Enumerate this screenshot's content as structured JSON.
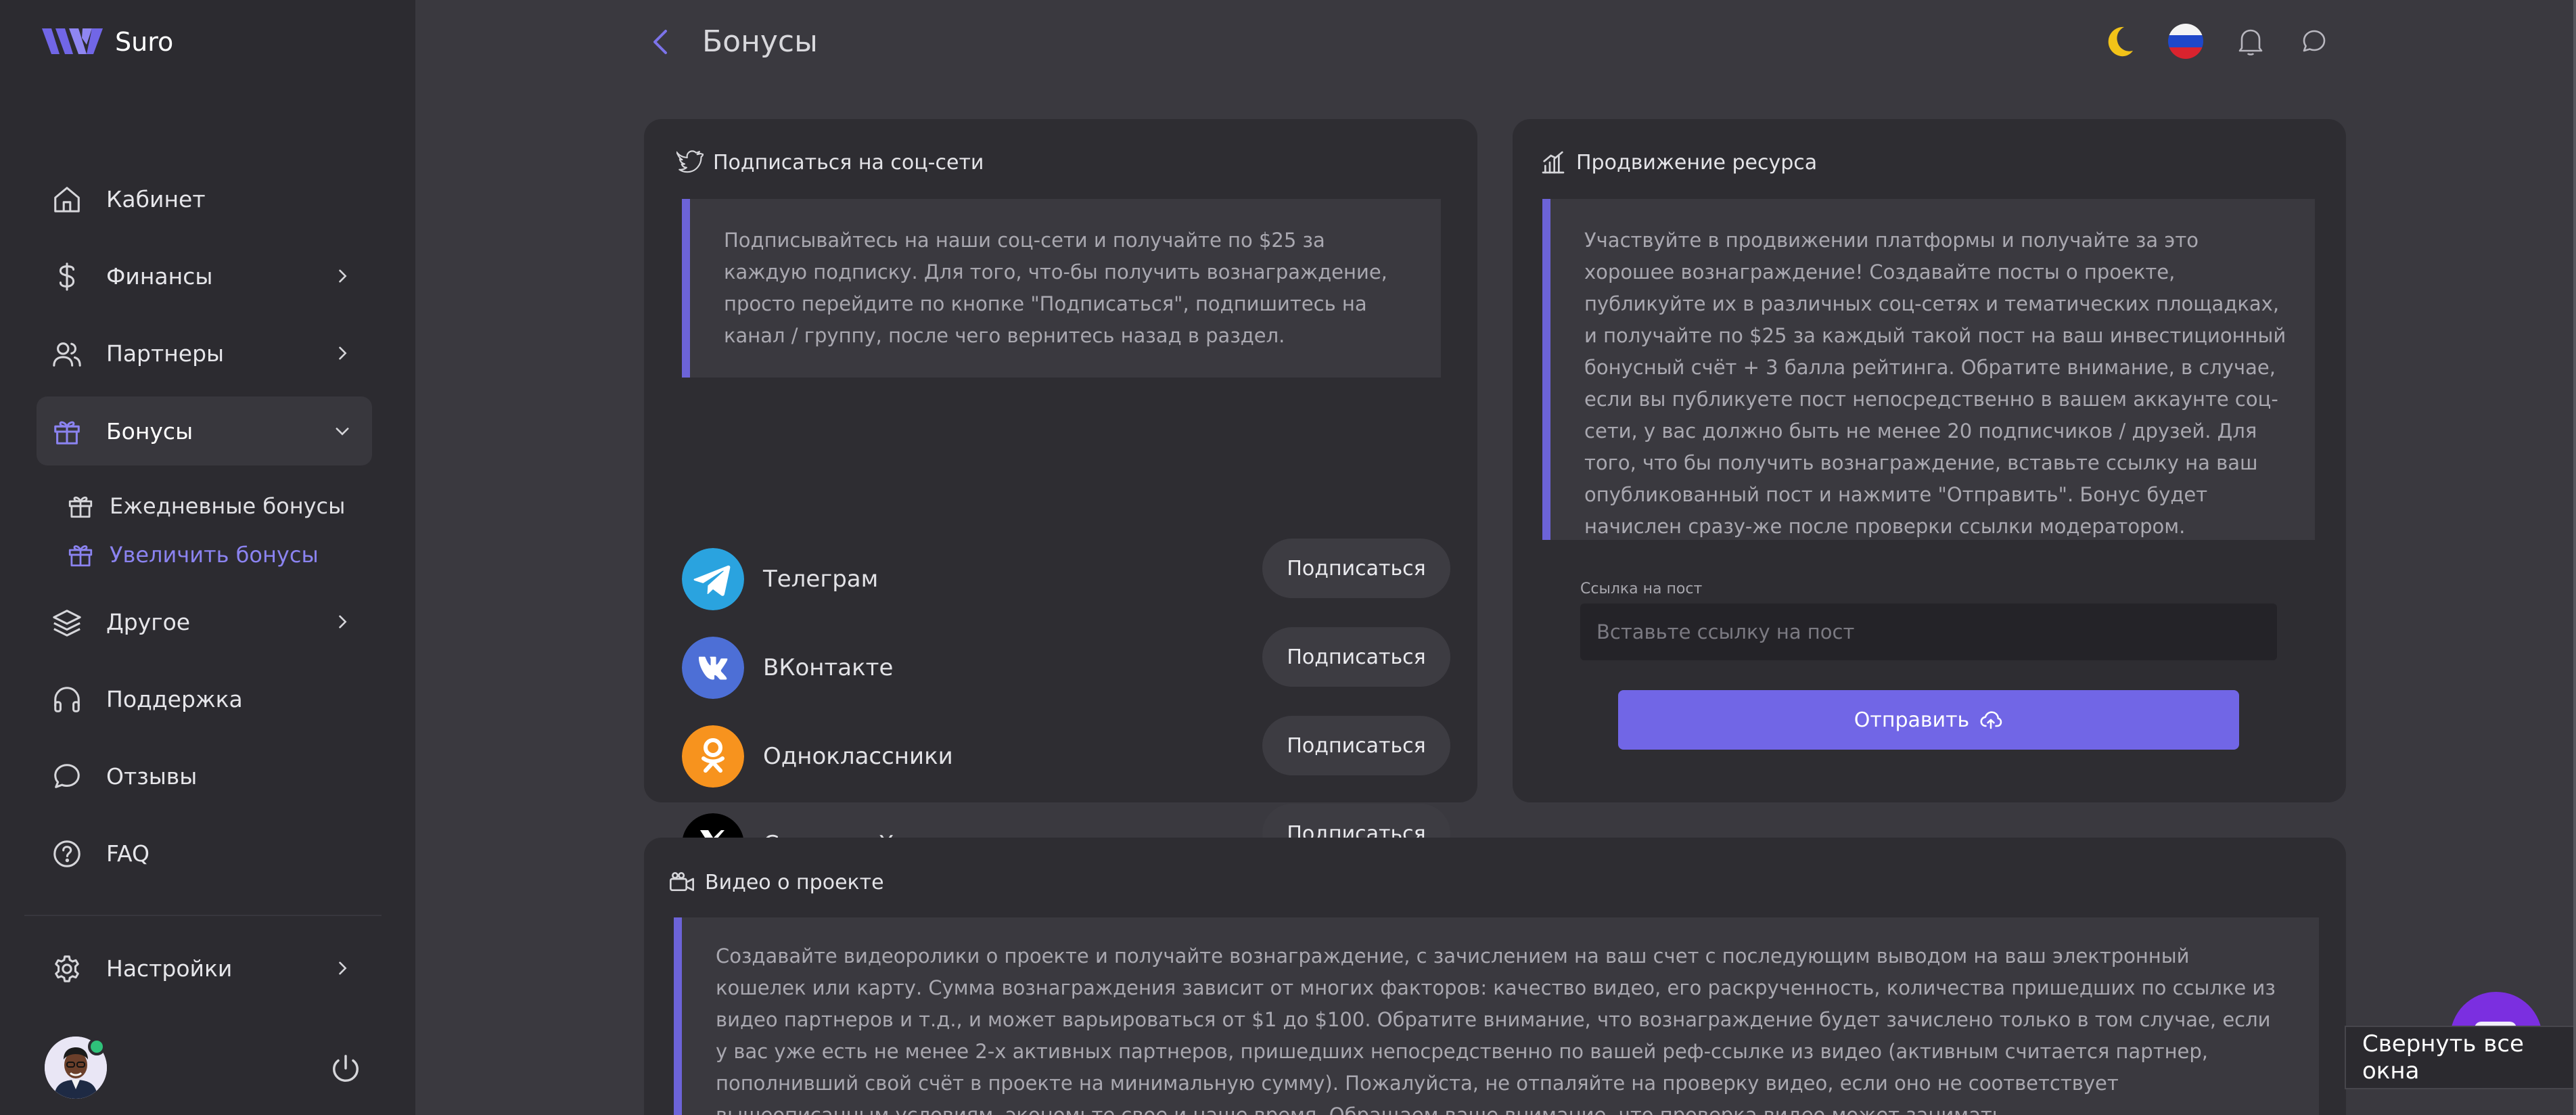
{
  "app": {
    "name": "Suro",
    "accent": "#6c63d8"
  },
  "sidebar": {
    "items": [
      {
        "label": "Кабинет",
        "icon": "home-icon"
      },
      {
        "label": "Финансы",
        "icon": "dollar-icon"
      },
      {
        "label": "Партнеры",
        "icon": "users-icon"
      },
      {
        "label": "Бонусы",
        "icon": "gift-icon"
      },
      {
        "label": "Другое",
        "icon": "layers-icon"
      },
      {
        "label": "Поддержка",
        "icon": "headphones-icon"
      },
      {
        "label": "Отзывы",
        "icon": "chat-bubble-icon"
      },
      {
        "label": "FAQ",
        "icon": "help-circle-icon"
      },
      {
        "label": "Настройки",
        "icon": "gear-icon"
      }
    ],
    "bonus_sub": [
      {
        "label": "Ежедневные бонусы",
        "icon": "gift-icon"
      },
      {
        "label": "Увеличить бонусы",
        "icon": "gift-icon"
      }
    ]
  },
  "header": {
    "title": "Бонусы"
  },
  "social_card": {
    "title": "Подписаться на соц-сети",
    "description": "Подписывайтесь на наши соц-сети и получайте по $25 за каждую подписку. Для того, что-бы получить вознаграждение, просто перейдите по кнопке \"Подписаться\", подпишитесь на канал / группу, после чего вернитесь назад в раздел.",
    "networks": [
      {
        "name": "Телеграм",
        "button": "Подписаться",
        "color": "#2aa3df"
      },
      {
        "name": "ВКонтакте",
        "button": "Подписаться",
        "color": "#4d6fd6"
      },
      {
        "name": "Одноклассники",
        "button": "Подписаться",
        "color": "#f7931e"
      },
      {
        "name": "Соц-сеть X",
        "button": "Подписаться",
        "color": "#000000"
      }
    ]
  },
  "promo_card": {
    "title": "Продвижение ресурса",
    "description": "Участвуйте в продвижении платформы и получайте за это хорошее вознаграждение! Создавайте посты о проекте, публикуйте их в различных соц-сетях и тематических площадках, и получайте по $25 за каждый такой пост на ваш инвестиционный бонусный счёт + 3 балла рейтинга. Обратите внимание, в случае, если вы публикуете пост непосредственно в вашем аккаунте соц-сети, у вас должно быть не менее 20 подписчиков / друзей. Для того, что бы получить вознаграждение, вставьте ссылку на ваш опубликованный пост и нажмите \"Отправить\". Бонус будет начислен сразу-же после проверки ссылки модератором.",
    "field_label": "Ссылка на пост",
    "field_placeholder": "Вставьте ссылку на пост",
    "field_value": "",
    "submit_label": "Отправить"
  },
  "video_card": {
    "title": "Видео о проекте",
    "description": "Создавайте видеоролики о проекте и получайте вознаграждение, с зачислением на ваш счет с последующим выводом на ваш электронный кошелек или карту. Сумма вознаграждения зависит от многих факторов: качество видео, его раскрученность, количества пришедших по ссылке из видео партнеров и т.д., и может варьироваться от $1 до $100. Обратите внимание, что вознаграждение будет зачислено только в том случае, если у вас уже есть не менее 2-х активных партнеров, пришедших непосредственно по вашей реф-ссылке из видео (активным считается партнер, пополнивший свой счёт в проекте на минимальную сумму). Пожалуйста, не отпаляйте на проверку видео, если оно не соответствует вышеописанным условиям, экономьте свое и наше время. Обращаем ваше внимание, что проверка видео может занимать"
  },
  "tooltip": {
    "text": "Свернуть все окна"
  }
}
